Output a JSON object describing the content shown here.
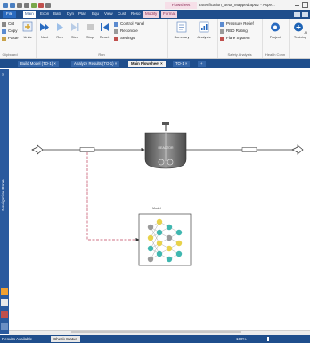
{
  "title_bar": {
    "contextual_tab": "Flowsheet",
    "window_title": "Esterification_Beta_Mapped.apwz - Aspe..."
  },
  "ribbon_tabs": [
    {
      "label": "File"
    },
    {
      "label": "Main"
    },
    {
      "label": "Econ"
    },
    {
      "label": "Batc"
    },
    {
      "label": "Dyn"
    },
    {
      "label": "Plan"
    },
    {
      "label": "Equ"
    },
    {
      "label": "View"
    },
    {
      "label": "Cust"
    },
    {
      "label": "Reso"
    },
    {
      "label": "Modify"
    },
    {
      "label": "Format"
    }
  ],
  "ribbon": {
    "clipboard": {
      "cut": "Cut",
      "copy": "Copy",
      "paste": "Paste",
      "label": "Clipboard"
    },
    "units": {
      "label": "Units"
    },
    "run": {
      "next": "Next",
      "run": "Run",
      "step": "Step",
      "stop": "Stop",
      "reset": "Reset",
      "control_panel": "Control Panel",
      "reconcile": "Reconcile",
      "settings": "Settings",
      "label": "Run"
    },
    "summary": {
      "summary": "Summary",
      "analysis": "Analysis"
    },
    "safety": {
      "pressure_relief": "Pressure Relief",
      "rbd_rating": "RBD Rating",
      "flare_system": "Flare System",
      "label": "Safety Analysis"
    },
    "project": {
      "label": "Project",
      "group": "Health Conn"
    },
    "training": {
      "label": "AI Training"
    }
  },
  "doc_tabs": [
    {
      "label": "Build Model (TO-1) ×"
    },
    {
      "label": "Analyze Results (TO-1) ×"
    },
    {
      "label": "Main Flowsheet ×"
    },
    {
      "label": "TO-1 ×"
    },
    {
      "label": "+"
    }
  ],
  "nav_pane": {
    "label": "Navigation Pane"
  },
  "flowsheet": {
    "reactor_label": "REACTOR",
    "ai_label": "Model"
  },
  "status_bar": {
    "message": "Results Available",
    "check_status": "Check Status",
    "zoom": "100%"
  },
  "colors": {
    "ribbon_blue": "#1f4e8c",
    "reactor_body": "#6f6f6f",
    "ai_node_yellow": "#e8d24a",
    "ai_node_teal": "#3fb7b0",
    "ai_node_gray": "#9a9a9a",
    "signal_line": "#c0435e"
  }
}
